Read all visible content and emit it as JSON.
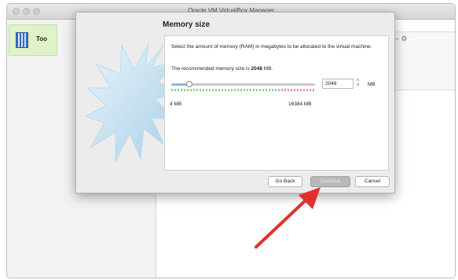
{
  "window": {
    "title": "Oracle VM VirtualBox Manager"
  },
  "sidebar": {
    "tools_label": "Too"
  },
  "dialog": {
    "title": "Memory size",
    "description": "Select the amount of memory (RAM) in megabytes to be allocated to the virtual machine.",
    "recommended_prefix": "The recommended memory size is ",
    "recommended_value": "2048",
    "recommended_suffix": " MB.",
    "memory": {
      "value": "2048",
      "unit": "MB",
      "min_label": "4 MB",
      "max_label": "16384 MB",
      "min": 4,
      "max": 16384,
      "current": 2048
    },
    "buttons": {
      "back": "Go Back",
      "continue": "Continue",
      "cancel": "Cancel"
    }
  },
  "colors": {
    "annotation_arrow": "#e0302a",
    "tools_highlight": "#dff2c8",
    "slider_fill": "#8fb6e8"
  }
}
